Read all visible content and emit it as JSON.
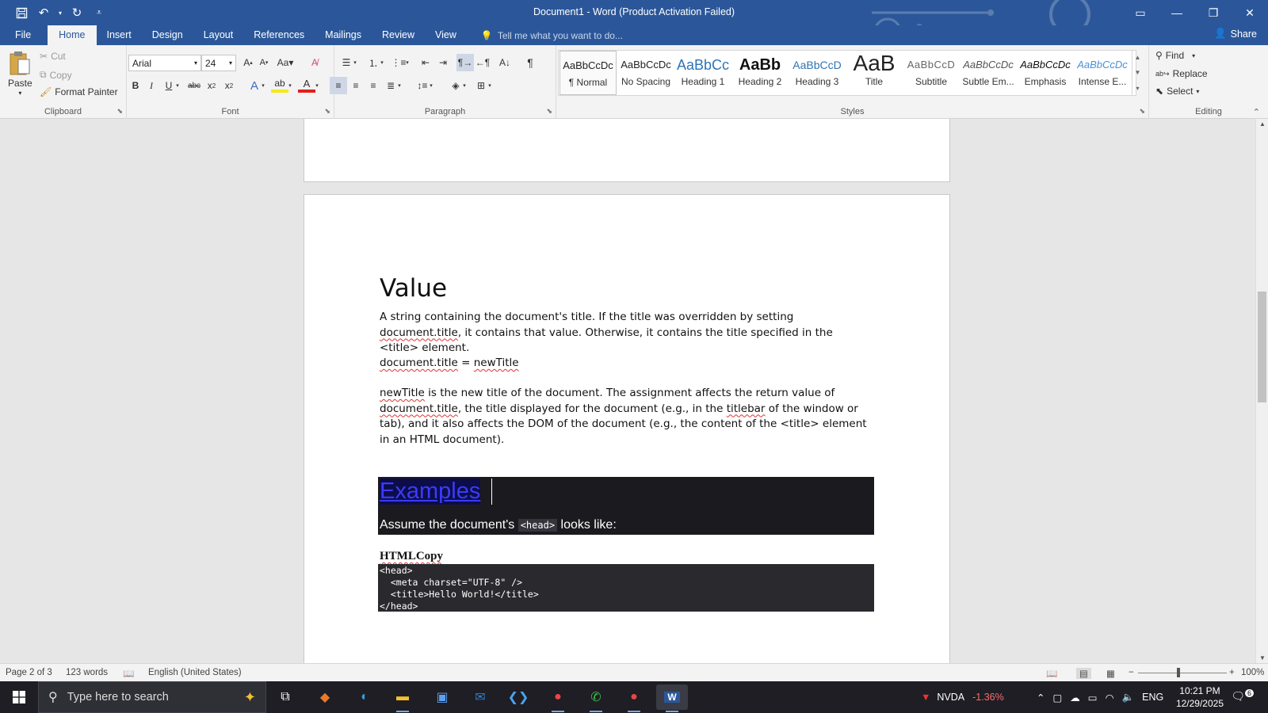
{
  "window": {
    "title": "Document1 - Word (Product Activation Failed)"
  },
  "tabs": [
    "File",
    "Home",
    "Insert",
    "Design",
    "Layout",
    "References",
    "Mailings",
    "Review",
    "View"
  ],
  "tell_me": "Tell me what you want to do...",
  "share": "Share",
  "clipboard": {
    "paste": "Paste",
    "cut": "Cut",
    "copy": "Copy",
    "format_painter": "Format Painter",
    "label": "Clipboard"
  },
  "font": {
    "name": "Arial",
    "size": "24",
    "label": "Font"
  },
  "paragraph": {
    "label": "Paragraph"
  },
  "styles": {
    "label": "Styles",
    "items": [
      {
        "preview": "AaBbCcDc",
        "name": "¶ Normal"
      },
      {
        "preview": "AaBbCcDc",
        "name": "No Spacing"
      },
      {
        "preview": "AaBbCc",
        "name": "Heading 1"
      },
      {
        "preview": "AaBb",
        "name": "Heading 2"
      },
      {
        "preview": "AaBbCcD",
        "name": "Heading 3"
      },
      {
        "preview": "AaB",
        "name": "Title"
      },
      {
        "preview": "AaBbCcD",
        "name": "Subtitle"
      },
      {
        "preview": "AaBbCcDc",
        "name": "Subtle Em..."
      },
      {
        "preview": "AaBbCcDc",
        "name": "Emphasis"
      },
      {
        "preview": "AaBbCcDc",
        "name": "Intense E..."
      }
    ]
  },
  "editing": {
    "find": "Find",
    "replace": "Replace",
    "select": "Select",
    "label": "Editing"
  },
  "document": {
    "heading": "Value",
    "p1_a": "A string containing the document's title. If the title was overridden by setting ",
    "p1_sq": "document.title",
    "p1_b": ", it contains that value. Otherwise, it contains the title specified in the <title> element.",
    "p2_a": "document.title",
    "p2_b": " = ",
    "p2_c": "newTitle",
    "p3_a": "newTitle",
    "p3_b": " is the new title of the document. The assignment affects the return value of ",
    "p3_c": "document.title",
    "p3_d": ", the title displayed for the document (e.g., in the ",
    "p3_e": "titlebar",
    "p3_f": " of the window or tab), and it also affects the DOM of the document (e.g., the content of the <title> element in an HTML document).",
    "examples": "Examples",
    "assume_a": "Assume the document's ",
    "assume_code": "<head>",
    "assume_b": " looks like:",
    "htmlcopy": "HTMLCopy",
    "code": [
      "<head>",
      "  <meta charset=\"UTF-8\" />",
      "  <title>Hello World!</title>",
      "</head>"
    ]
  },
  "status": {
    "page": "Page 2 of 3",
    "words": "123 words",
    "language": "English (United States)",
    "zoom": "100%"
  },
  "taskbar": {
    "search_placeholder": "Type here to search",
    "stock_name": "NVDA",
    "stock_change": "-1.36%",
    "lang": "ENG",
    "time": "10:21 PM",
    "date": "12/29/2025",
    "notif_count": "6"
  }
}
